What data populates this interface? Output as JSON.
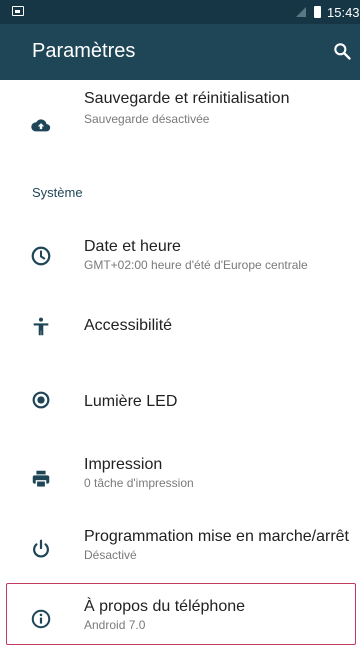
{
  "status": {
    "time": "15:43"
  },
  "appbar": {
    "title": "Paramètres"
  },
  "section_system": "Système",
  "items": [
    {
      "title": "Sauvegarde et réinitialisation",
      "subtitle": "Sauvegarde désactivée",
      "icon": "cloud-upload-icon"
    },
    {
      "title": "Date et heure",
      "subtitle": "GMT+02:00 heure d'été d'Europe centrale",
      "icon": "clock-icon"
    },
    {
      "title": "Accessibilité",
      "subtitle": "",
      "icon": "accessibility-icon"
    },
    {
      "title": "Lumière LED",
      "subtitle": "",
      "icon": "led-light-icon"
    },
    {
      "title": "Impression",
      "subtitle": "0 tâche d'impression",
      "icon": "printer-icon"
    },
    {
      "title": "Programmation mise en marche/arrêt",
      "subtitle": "Désactivé",
      "icon": "power-schedule-icon"
    },
    {
      "title": "À propos du téléphone",
      "subtitle": "Android 7.0",
      "icon": "info-icon"
    }
  ],
  "colors": {
    "appbar": "#1f4657",
    "statusbar": "#163646",
    "icon": "#1f4657",
    "highlight": "#c23a5f"
  }
}
